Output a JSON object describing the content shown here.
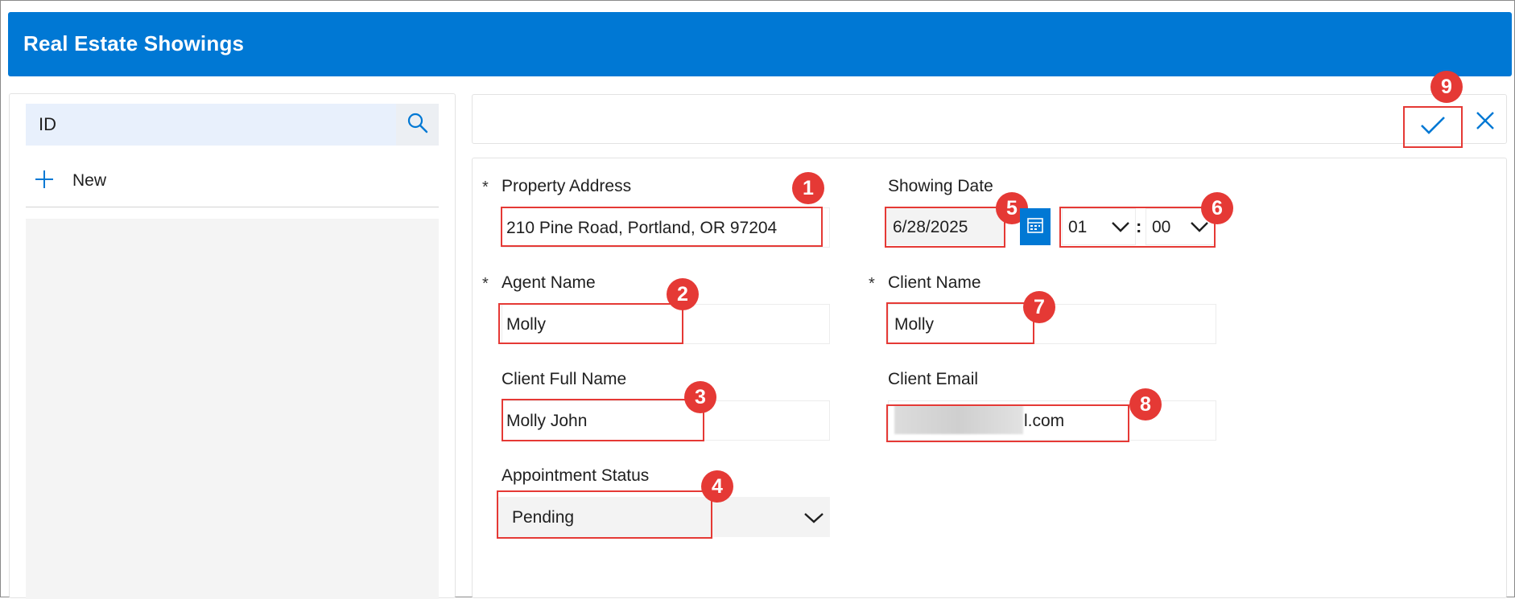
{
  "header": {
    "title": "Real Estate Showings"
  },
  "sidebar": {
    "search": {
      "value": "ID",
      "icon": "search-icon"
    },
    "new_label": "New",
    "new_icon": "plus-icon"
  },
  "toolbar": {
    "save_icon": "checkmark-icon",
    "cancel_icon": "close-icon"
  },
  "form": {
    "required_marker": "*",
    "property_address": {
      "label": "Property Address",
      "value": "210 Pine Road, Portland, OR 97204"
    },
    "showing_date": {
      "label": "Showing Date",
      "date": "6/28/2025",
      "hour": "01",
      "minute": "00",
      "time_separator": ":"
    },
    "agent_name": {
      "label": "Agent Name",
      "value": "Molly"
    },
    "client_name": {
      "label": "Client Name",
      "value": "Molly"
    },
    "client_full_name": {
      "label": "Client Full Name",
      "value": "Molly John"
    },
    "client_email": {
      "label": "Client Email",
      "value_visible": "l.com"
    },
    "appointment_status": {
      "label": "Appointment Status",
      "value": "Pending"
    }
  },
  "annotations": [
    "1",
    "2",
    "3",
    "4",
    "5",
    "6",
    "7",
    "8",
    "9"
  ],
  "colors": {
    "brand": "#0078d4",
    "annotation": "#e53935"
  }
}
